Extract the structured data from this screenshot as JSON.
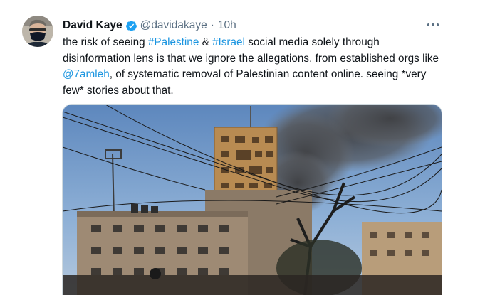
{
  "tweet": {
    "author_name": "David Kaye",
    "handle": "@davidakaye",
    "separator": "·",
    "time": "10h",
    "text": {
      "t1": "the risk of seeing ",
      "hashtag1": "#Palestine",
      "t2": " & ",
      "hashtag2": "#Israel",
      "t3": " social media solely through disinformation lens is that we ignore the allegations, from established orgs like ",
      "mention": "@7amleh",
      "t4": ", of systematic removal of Palestinian content online. seeing *very few* stories about that."
    }
  },
  "icons": {
    "verified": "verified-badge-icon",
    "more": "more-options-icon"
  },
  "colors": {
    "link": "#1b95e0",
    "secondary_text": "#5b7083",
    "verified": "#1da1f2"
  }
}
